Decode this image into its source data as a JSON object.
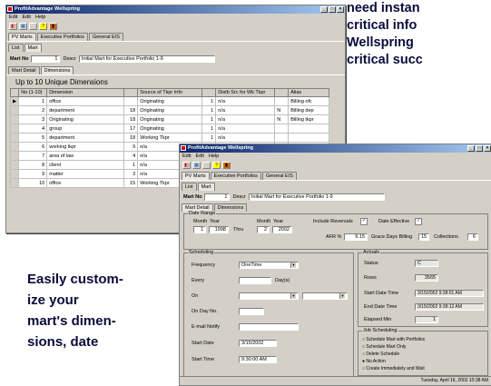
{
  "promo": {
    "top_lines": [
      "need instan",
      "critical info",
      "Wellspring",
      "critical succ"
    ],
    "bottom_lines": [
      "Easily custom-",
      "ize your",
      "mart's dimen-",
      "sions, date"
    ]
  },
  "win1": {
    "title": "ProfitAdvantage Wellspring",
    "menu": [
      "Edit",
      "Edit",
      "Help"
    ],
    "tabs": [
      "PV Marts",
      "Executive Portfolios",
      "General EIS"
    ],
    "subtabs": [
      "List",
      "Mart"
    ],
    "mart_no_label": "Mart No",
    "mart_no_value": "1",
    "descr_label": "Descr",
    "descr_value": "Initial Mart for Executive Portfolio 1-9",
    "detail_tabs": [
      "Mart Detail",
      "Dimensions"
    ],
    "heading": "Up to 10 Unique Dimensions",
    "columns": [
      "No (1-10)",
      "Dimension",
      "",
      "Source of Tkpr Info",
      "",
      "Distb Src for Wk Tkpr",
      "",
      "Alias"
    ],
    "rows": [
      {
        "no": "1",
        "dim": "office",
        "n1": "",
        "src": "Originating",
        "n2": "1",
        "dist": "n/a",
        "flag": "",
        "alias": "Billing ofc"
      },
      {
        "no": "2",
        "dim": "department",
        "n1": "18",
        "src": "Originating",
        "n2": "1",
        "dist": "n/a",
        "flag": "N",
        "alias": "Billing dep"
      },
      {
        "no": "3",
        "dim": "Originating",
        "n1": "18",
        "src": "Originating",
        "n2": "1",
        "dist": "n/a",
        "flag": "N",
        "alias": "Billing tkpr"
      },
      {
        "no": "4",
        "dim": "group",
        "n1": "17",
        "src": "Originating",
        "n2": "1",
        "dist": "n/a",
        "flag": "",
        "alias": ""
      },
      {
        "no": "5",
        "dim": "department",
        "n1": "18",
        "src": "Working Tkpr",
        "n2": "1",
        "dist": "n/a",
        "flag": "",
        "alias": ""
      },
      {
        "no": "6",
        "dim": "working tkpr",
        "n1": "9",
        "src": "n/a",
        "n2": "",
        "dist": "",
        "flag": "",
        "alias": ""
      },
      {
        "no": "7",
        "dim": "area of law",
        "n1": "4",
        "src": "n/a",
        "n2": "",
        "dist": "",
        "flag": "",
        "alias": ""
      },
      {
        "no": "8",
        "dim": "client",
        "n1": "1",
        "src": "n/a",
        "n2": "",
        "dist": "",
        "flag": "",
        "alias": ""
      },
      {
        "no": "9",
        "dim": "matter",
        "n1": "3",
        "src": "n/a",
        "n2": "",
        "dist": "",
        "flag": "",
        "alias": ""
      },
      {
        "no": "10",
        "dim": "office",
        "n1": "15",
        "src": "Working Tkpr",
        "n2": "",
        "dist": "",
        "flag": "",
        "alias": ""
      }
    ]
  },
  "win2": {
    "title": "ProfitAdvantage Wellspring",
    "menu": [
      "Edit",
      "Edit",
      "Help"
    ],
    "tabs": [
      "PV Marts",
      "Executive Portfolios",
      "General EIS"
    ],
    "subtabs": [
      "List",
      "Mart"
    ],
    "mart_no_label": "Mart No",
    "mart_no_value": "1",
    "descr_label": "Descr",
    "descr_value": "Initial Mart for Executive Portfolio 1-9",
    "detail_tabs": [
      "Mart Detail",
      "Dimensions"
    ],
    "date_range": {
      "title": "Date Range",
      "month_label": "Month",
      "year_label": "Year",
      "from_month": "1",
      "from_year": "1998",
      "thru_label": "Thru",
      "to_month": "2",
      "to_year": "2002",
      "include_reversals_label": "Include Reversals",
      "date_effective_label": "Date Effective",
      "afr_label": "AFR %",
      "afr_value": "9.15",
      "grace_label": "Grace Days Billing",
      "grace_value": "15",
      "collections_label": "Collections",
      "collections_value": "6"
    },
    "scheduling": {
      "title": "Scheduling",
      "frequency_label": "Frequency",
      "frequency_value": "OneTime",
      "every_label": "Every",
      "every_unit": "Day(s)",
      "on_label": "On",
      "on_day_label": "On Day No.",
      "email_label": "E-mail Notify",
      "start_date_label": "Start Date",
      "start_date_value": "3/15/2002",
      "start_time_label": "Start Time",
      "start_time_value": "9:30:00 AM"
    },
    "actuals": {
      "title": "Actuals",
      "status_label": "Status",
      "status_value": "C",
      "rows_label": "Rows",
      "rows_value": "3565",
      "start_label": "Start Date Time",
      "start_value": "3/15/2002 9:38:01 AM",
      "end_label": "End Date Time",
      "end_value": "3/15/2002 9:38:12 AM",
      "elapsed_label": "Elapsed Min",
      "elapsed_value": "1"
    },
    "job": {
      "title": "Job Scheduling",
      "options": [
        "Schedule Mart with Portfolios",
        "Schedule Mart Only",
        "Delete Schedule",
        "No Action",
        "Create Immediately and Wait"
      ]
    },
    "status_text": "Tuesday, April 16, 2002 10:38 AM"
  }
}
